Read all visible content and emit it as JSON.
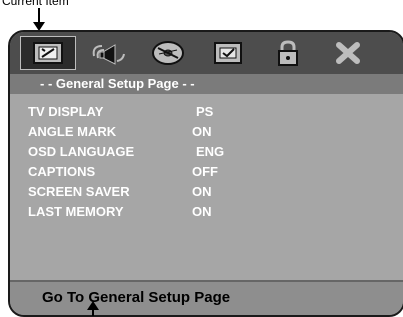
{
  "callout": {
    "current_item": "Current Item"
  },
  "osd": {
    "title": "- -   General Setup Page   - -",
    "icons": [
      {
        "name": "general-setup-icon"
      },
      {
        "name": "audio-setup-icon"
      },
      {
        "name": "disc-setup-icon"
      },
      {
        "name": "preference-icon"
      },
      {
        "name": "lock-icon"
      },
      {
        "name": "exit-icon"
      }
    ],
    "settings": [
      {
        "label": "TV DISPLAY",
        "value": "PS"
      },
      {
        "label": "ANGLE MARK",
        "value": "ON"
      },
      {
        "label": "OSD LANGUAGE",
        "value": "ENG"
      },
      {
        "label": "CAPTIONS",
        "value": "OFF"
      },
      {
        "label": "SCREEN SAVER",
        "value": "ON"
      },
      {
        "label": "LAST MEMORY",
        "value": "ON"
      }
    ],
    "help_text": "Go To General Setup Page"
  },
  "colors": {
    "panel": "#9b9b9b",
    "menubar": "#4d4d4d",
    "text": "#ffffff",
    "footer_text": "#000000"
  }
}
